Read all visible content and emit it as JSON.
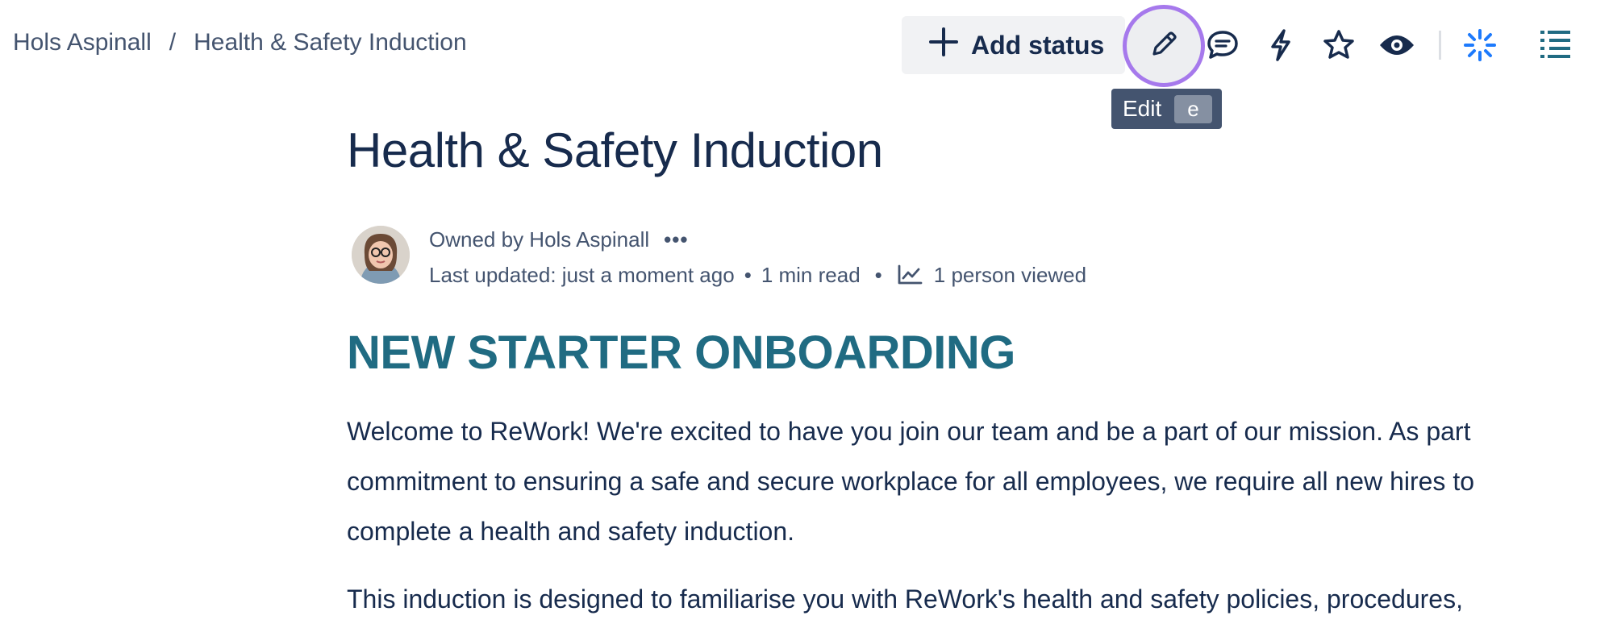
{
  "breadcrumb": {
    "items": [
      "Hols Aspinall",
      "Health & Safety Induction"
    ],
    "separator": "/"
  },
  "toolbar": {
    "add_status_label": "Add status",
    "icons": [
      "plus-icon",
      "edit-icon",
      "comment-icon",
      "automation-icon",
      "star-icon",
      "watch-icon",
      "loading-icon",
      "table-of-contents-icon"
    ],
    "tooltip": {
      "label": "Edit",
      "shortcut": "e"
    }
  },
  "page": {
    "title": "Health & Safety Induction",
    "byline": {
      "owner": "Owned by Hols Aspinall",
      "more": "•••",
      "last_updated": "Last updated: just a moment ago",
      "read_time": "1 min read",
      "views": "1 person viewed",
      "separator": "•"
    },
    "heading": "NEW STARTER ONBOARDING",
    "paragraphs": [
      [
        "Welcome to ReWork! We're excited to have you join our team and be a part of our mission. As part",
        "commitment to ensuring a safe and secure workplace for all employees, we require all new hires to",
        "complete a health and safety induction."
      ],
      [
        "This induction is designed to familiarise you with ReWork's health and safety policies, procedures,"
      ]
    ]
  },
  "colors": {
    "text": "#172B4D",
    "subtle": "#44546F",
    "heading": "#206B82",
    "highlight_ring": "#A679EC",
    "loader": "#1D7AFC"
  }
}
